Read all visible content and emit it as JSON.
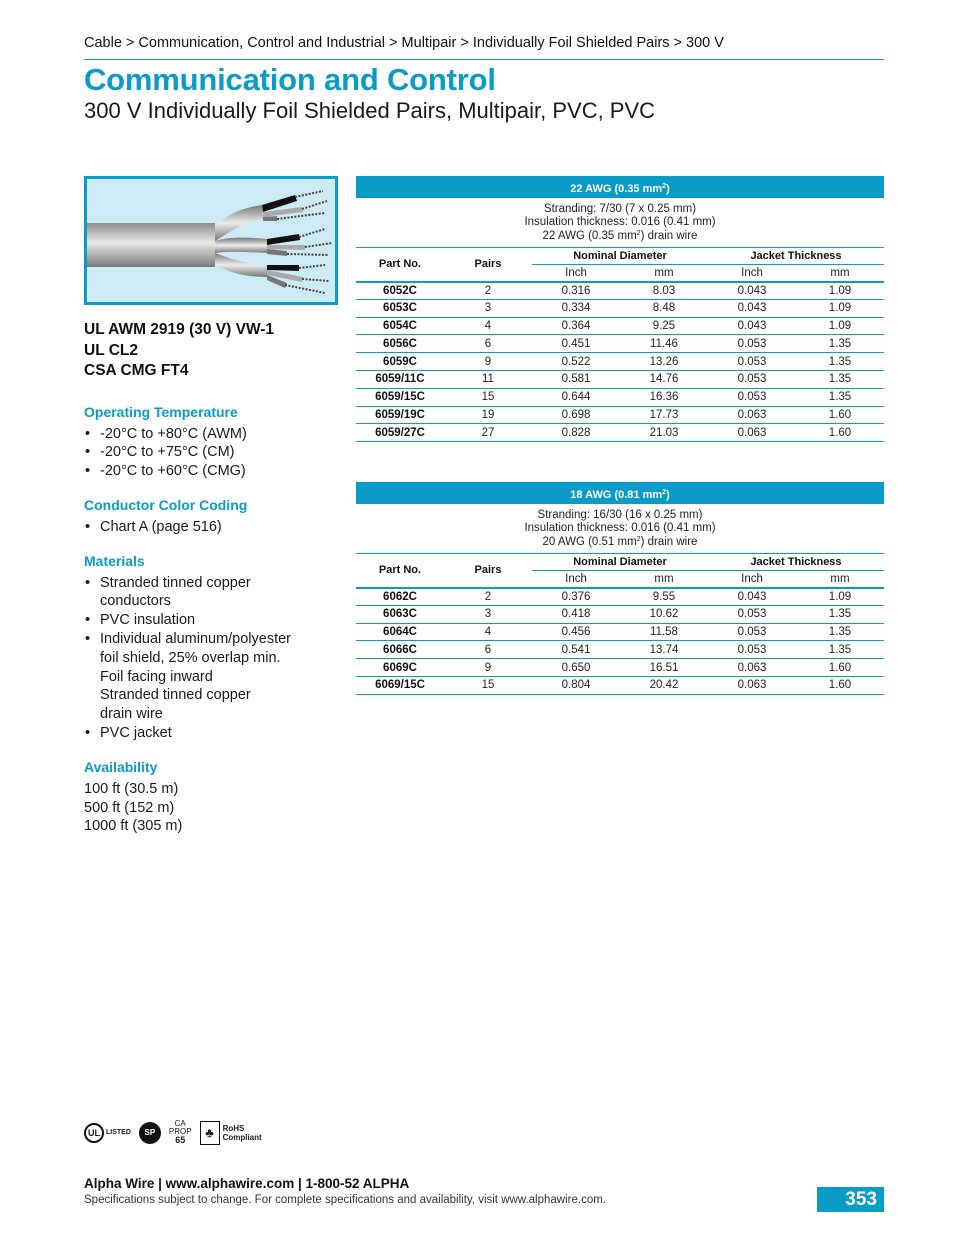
{
  "breadcrumb": "Cable > Communication, Control and Industrial > Multipair > Individually Foil Shielded Pairs > 300 V",
  "title": "Communication and Control",
  "subtitle": "300 V Individually Foil Shielded Pairs, Multipair, PVC, PVC",
  "approvals": [
    "UL AWM 2919 (30 V) VW-1",
    "UL CL2",
    "CSA CMG FT4"
  ],
  "operating_temperature": {
    "heading": "Operating Temperature",
    "items": [
      "-20°C to +80°C (AWM)",
      "-20°C to +75°C (CM)",
      "-20°C to +60°C (CMG)"
    ]
  },
  "color_coding": {
    "heading": "Conductor Color Coding",
    "items": [
      "Chart A (page 516)"
    ]
  },
  "materials": {
    "heading": "Materials",
    "items": [
      "Stranded tinned copper",
      "conductors",
      "PVC insulation",
      "Individual aluminum/polyester",
      "foil shield, 25% overlap min.",
      "Foil facing inward",
      "Stranded tinned copper",
      "drain wire",
      "PVC jacket"
    ]
  },
  "availability": {
    "heading": "Availability",
    "items": [
      "100 ft (30.5 m)",
      "500 ft (152 m)",
      "1000 ft (305 m)"
    ]
  },
  "table_headers": {
    "part_no": "Part No.",
    "pairs": "Pairs",
    "nominal_diameter": "Nominal Diameter",
    "jacket_thickness": "Jacket Thickness",
    "inch": "Inch",
    "mm": "mm"
  },
  "tables": [
    {
      "awg_prefix": "22 AWG (0.35 mm",
      "awg_suffix": ")",
      "stranding": "Stranding: 7/30 (7 x 0.25 mm)",
      "insulation": "Insulation thickness: 0.016 (0.41 mm)",
      "drain_prefix": "22 AWG (0.35 mm",
      "drain_suffix": ") drain wire",
      "rows": [
        [
          "6052C",
          "2",
          "0.316",
          "8.03",
          "0.043",
          "1.09"
        ],
        [
          "6053C",
          "3",
          "0.334",
          "8.48",
          "0.043",
          "1.09"
        ],
        [
          "6054C",
          "4",
          "0.364",
          "9.25",
          "0.043",
          "1.09"
        ],
        [
          "6056C",
          "6",
          "0.451",
          "11.46",
          "0.053",
          "1.35"
        ],
        [
          "6059C",
          "9",
          "0.522",
          "13.26",
          "0.053",
          "1.35"
        ],
        [
          "6059/11C",
          "11",
          "0.581",
          "14.76",
          "0.053",
          "1.35"
        ],
        [
          "6059/15C",
          "15",
          "0.644",
          "16.36",
          "0.053",
          "1.35"
        ],
        [
          "6059/19C",
          "19",
          "0.698",
          "17.73",
          "0.063",
          "1.60"
        ],
        [
          "6059/27C",
          "27",
          "0.828",
          "21.03",
          "0.063",
          "1.60"
        ]
      ]
    },
    {
      "awg_prefix": "18 AWG (0.81 mm",
      "awg_suffix": ")",
      "stranding": "Stranding: 16/30 (16 x 0.25 mm)",
      "insulation": "Insulation thickness: 0.016 (0.41 mm)",
      "drain_prefix": "20 AWG (0.51 mm",
      "drain_suffix": ") drain wire",
      "rows": [
        [
          "6062C",
          "2",
          "0.376",
          "9.55",
          "0.043",
          "1.09"
        ],
        [
          "6063C",
          "3",
          "0.418",
          "10.62",
          "0.053",
          "1.35"
        ],
        [
          "6064C",
          "4",
          "0.456",
          "11.58",
          "0.053",
          "1.35"
        ],
        [
          "6066C",
          "6",
          "0.541",
          "13.74",
          "0.053",
          "1.35"
        ],
        [
          "6069C",
          "9",
          "0.650",
          "16.51",
          "0.063",
          "1.60"
        ],
        [
          "6069/15C",
          "15",
          "0.804",
          "20.42",
          "0.063",
          "1.60"
        ]
      ]
    }
  ],
  "certifications": {
    "ul": "UL",
    "ul_listed": "LISTED",
    "csa": "SP",
    "prop65_line1": "CA",
    "prop65_line2": "PROP",
    "prop65_line3": "65",
    "rohs_line1": "RoHS",
    "rohs_line2": "Compliant"
  },
  "footer": {
    "company": "Alpha Wire | www.alphawire.com | 1-800-52 ALPHA",
    "note": "Specifications subject to change. For complete specifications and availability, visit www.alphawire.com.",
    "page_number": "353"
  },
  "colors": {
    "accent": "#0a9bc6"
  }
}
